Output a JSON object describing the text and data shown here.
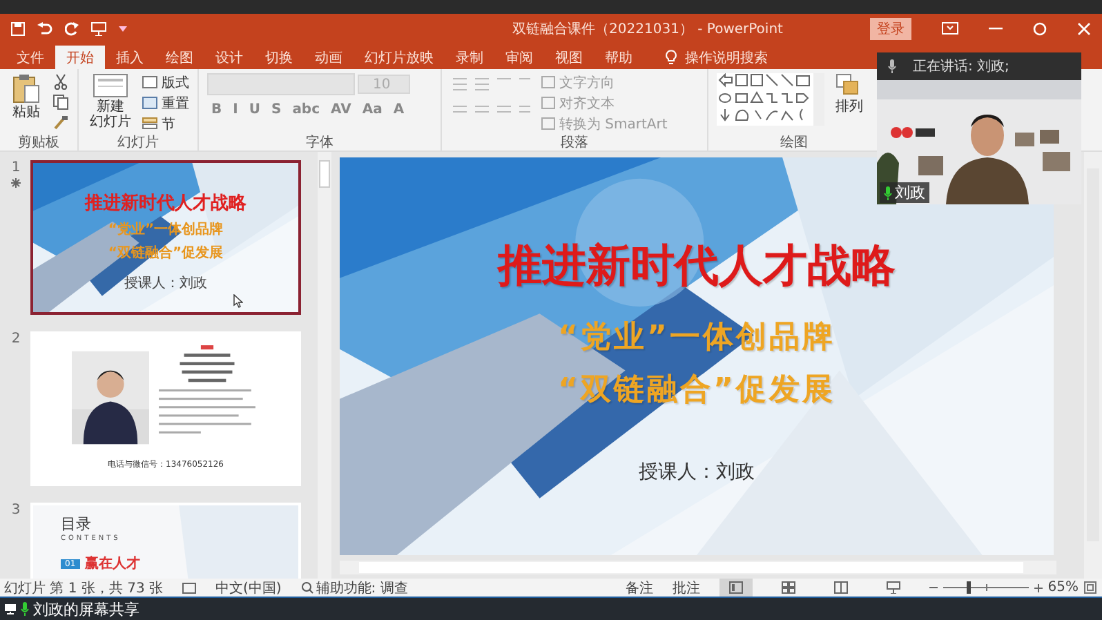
{
  "window": {
    "title": "双链融合课件（20221031） - PowerPoint",
    "sign_in": "登录"
  },
  "tabs": [
    {
      "label": "文件",
      "selected": false
    },
    {
      "label": "开始",
      "selected": true
    },
    {
      "label": "插入",
      "selected": false
    },
    {
      "label": "绘图",
      "selected": false
    },
    {
      "label": "设计",
      "selected": false
    },
    {
      "label": "切换",
      "selected": false
    },
    {
      "label": "动画",
      "selected": false
    },
    {
      "label": "幻灯片放映",
      "selected": false
    },
    {
      "label": "录制",
      "selected": false
    },
    {
      "label": "审阅",
      "selected": false
    },
    {
      "label": "视图",
      "selected": false
    },
    {
      "label": "帮助",
      "selected": false
    }
  ],
  "tell_me": "操作说明搜索",
  "clipboard": {
    "paste": "粘贴",
    "label": "剪贴板"
  },
  "slides_group": {
    "new_slide": [
      "新建",
      "幻灯片"
    ],
    "layout": "版式",
    "reset": "重置",
    "section": "节",
    "label": "幻灯片"
  },
  "font_group": {
    "font_size": "10",
    "buttons": [
      "B",
      "I",
      "U",
      "S",
      "abc",
      "AV",
      "Aa",
      "A"
    ],
    "label": "字体"
  },
  "paragraph_group": {
    "text_direction": "文字方向",
    "align_text": "对齐文本",
    "smartart": "转换为 SmartArt",
    "label": "段落"
  },
  "drawing_group": {
    "arrange": "排列",
    "label": "绘图"
  },
  "video": {
    "speaking": "正在讲话: 刘政;",
    "name": "刘政"
  },
  "slides": [
    {
      "number": "1",
      "kind": "title",
      "selected": true,
      "animated": true,
      "title": "推进新时代人才战略",
      "line_1": "“党业”一体创品牌",
      "line_2": "“双链融合”促发展",
      "presenter": "授课人：刘政"
    },
    {
      "number": "2",
      "kind": "profile",
      "selected": false,
      "animated": false,
      "contact": "电话与微信号：13476052126"
    },
    {
      "number": "3",
      "kind": "contents",
      "selected": false,
      "animated": false,
      "heading": "目录",
      "subheading": "CONTENTS",
      "item_number": "01",
      "item": "赢在人才"
    }
  ],
  "main_slide": {
    "title": "推进新时代人才战略",
    "line_1": "“党业”一体创品牌",
    "line_2": "“双链融合”促发展",
    "presenter": "授课人：刘政"
  },
  "status_bar": {
    "slide_info": "幻灯片 第 1 张，共 73 张",
    "language": "中文(中国)",
    "accessibility": "辅助功能: 调查",
    "notes": "备注",
    "comments": "批注",
    "views": [
      {
        "kind": "normal",
        "selected": true
      },
      {
        "kind": "sorter",
        "selected": false
      },
      {
        "kind": "reading",
        "selected": false
      },
      {
        "kind": "show",
        "selected": false
      }
    ],
    "zoom": {
      "level": 0.3,
      "reading": "65%"
    }
  },
  "share_bar": {
    "label": "刘政的屏幕共享"
  }
}
